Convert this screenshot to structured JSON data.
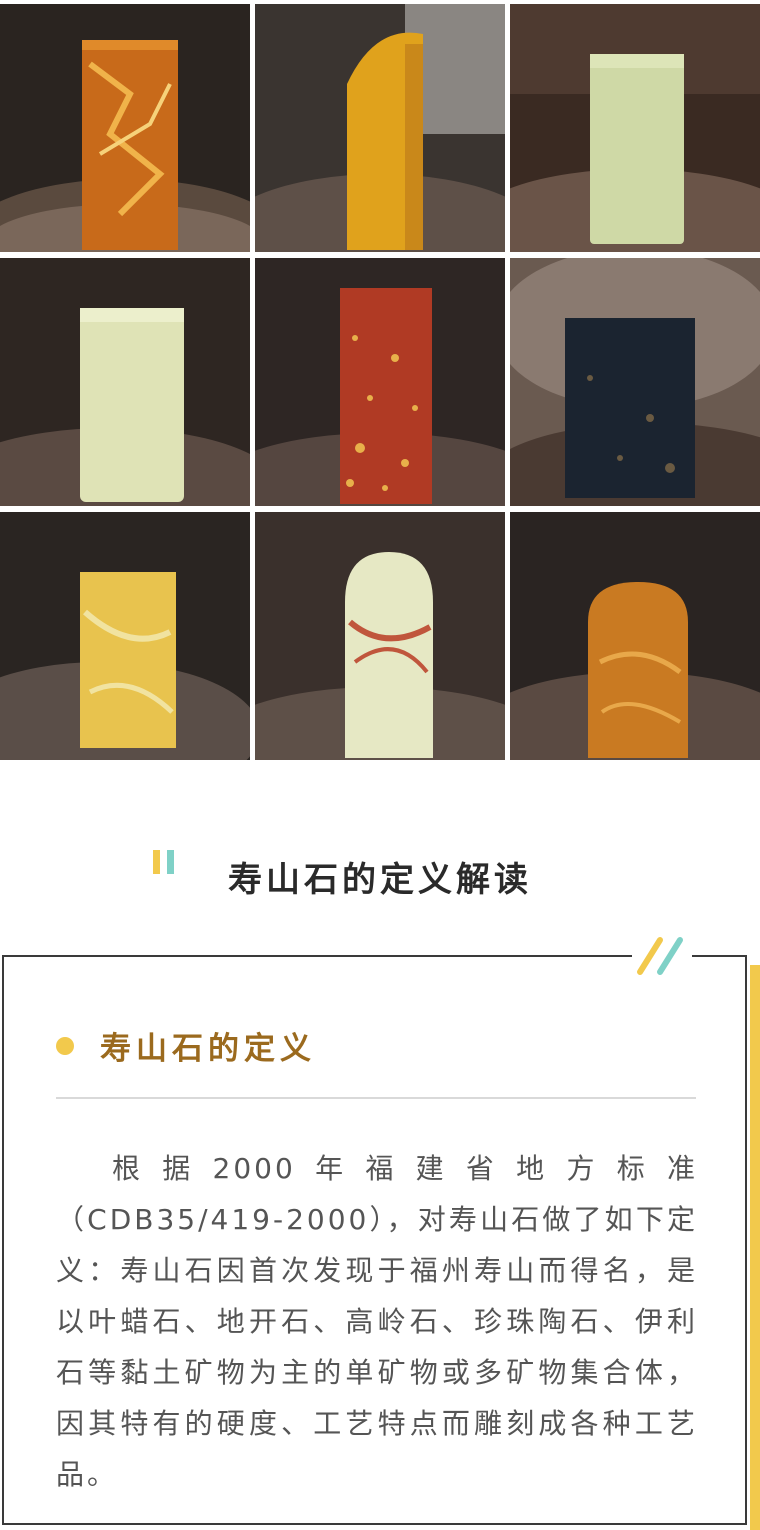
{
  "section": {
    "heading": "寿山石的定义解读",
    "subtitle": "寿山石的定义",
    "paragraph": "根据2000年福建省地方标准（CDB35/419-2000），对寿山石做了如下定义：寿山石因首次发现于福州寿山而得名，是以叶蜡石、地开石、高岭石、珍珠陶石、伊利石等黏土矿物为主的单矿物或多矿物集合体，因其特有的硬度、工艺特点而雕刻成各种工艺品。"
  },
  "colors": {
    "accent_yellow": "#f2c94c",
    "accent_teal": "#7fd1c7",
    "subtitle_brown": "#9b6a1e"
  },
  "gallery": [
    {
      "name": "orange-red-veined-stone",
      "stone": "#c86a1a",
      "vein": "#f0b34a"
    },
    {
      "name": "yellow-amber-stone",
      "stone": "#e0a21c",
      "vein": "#f3c85a"
    },
    {
      "name": "pale-green-stone",
      "stone": "#cfd9a6",
      "vein": "#e2e8bf"
    },
    {
      "name": "pale-yellow-green-stone",
      "stone": "#dfe3b6",
      "vein": "#eef0cf"
    },
    {
      "name": "red-speckled-stone",
      "stone": "#b03a24",
      "vein": "#e8b04a"
    },
    {
      "name": "black-speckled-stone",
      "stone": "#1b2430",
      "vein": "#6a5a42"
    },
    {
      "name": "yellow-marbled-stone",
      "stone": "#e8c34e",
      "vein": "#f1e3a0"
    },
    {
      "name": "white-red-veined-stone",
      "stone": "#e6e8c4",
      "vein": "#c0563c"
    },
    {
      "name": "golden-brown-stone",
      "stone": "#c97a22",
      "vein": "#e8a84a"
    }
  ]
}
